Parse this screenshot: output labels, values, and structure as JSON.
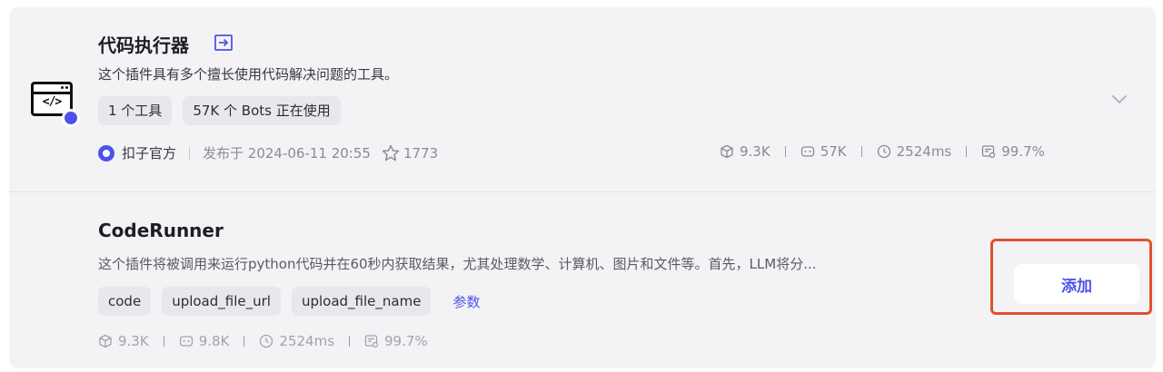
{
  "plugin": {
    "title": "代码执行器",
    "description": "这个插件具有多个擅长使用代码解决问题的工具。",
    "tags": [
      "1 个工具",
      "57K 个 Bots 正在使用"
    ],
    "author": "扣子官方",
    "published": "发布于 2024-06-11 20:55",
    "stars": "1773",
    "stats": {
      "calls": "9.3K",
      "bots": "57K",
      "latency": "2524ms",
      "success": "99.7%"
    }
  },
  "tool": {
    "title": "CodeRunner",
    "description": "这个插件将被调用来运行python代码并在60秒内获取结果，尤其处理数学、计算机、图片和文件等。首先，LLM将分...",
    "params": [
      "code",
      "upload_file_url",
      "upload_file_name"
    ],
    "params_link": "参数",
    "stats": {
      "calls": "9.3K",
      "bots": "9.8K",
      "latency": "2524ms",
      "success": "99.7%"
    },
    "add_button": "添加"
  },
  "colors": {
    "accent": "#4d53e8",
    "highlight": "#e0502e",
    "card_bg": "#f3f3f6"
  }
}
